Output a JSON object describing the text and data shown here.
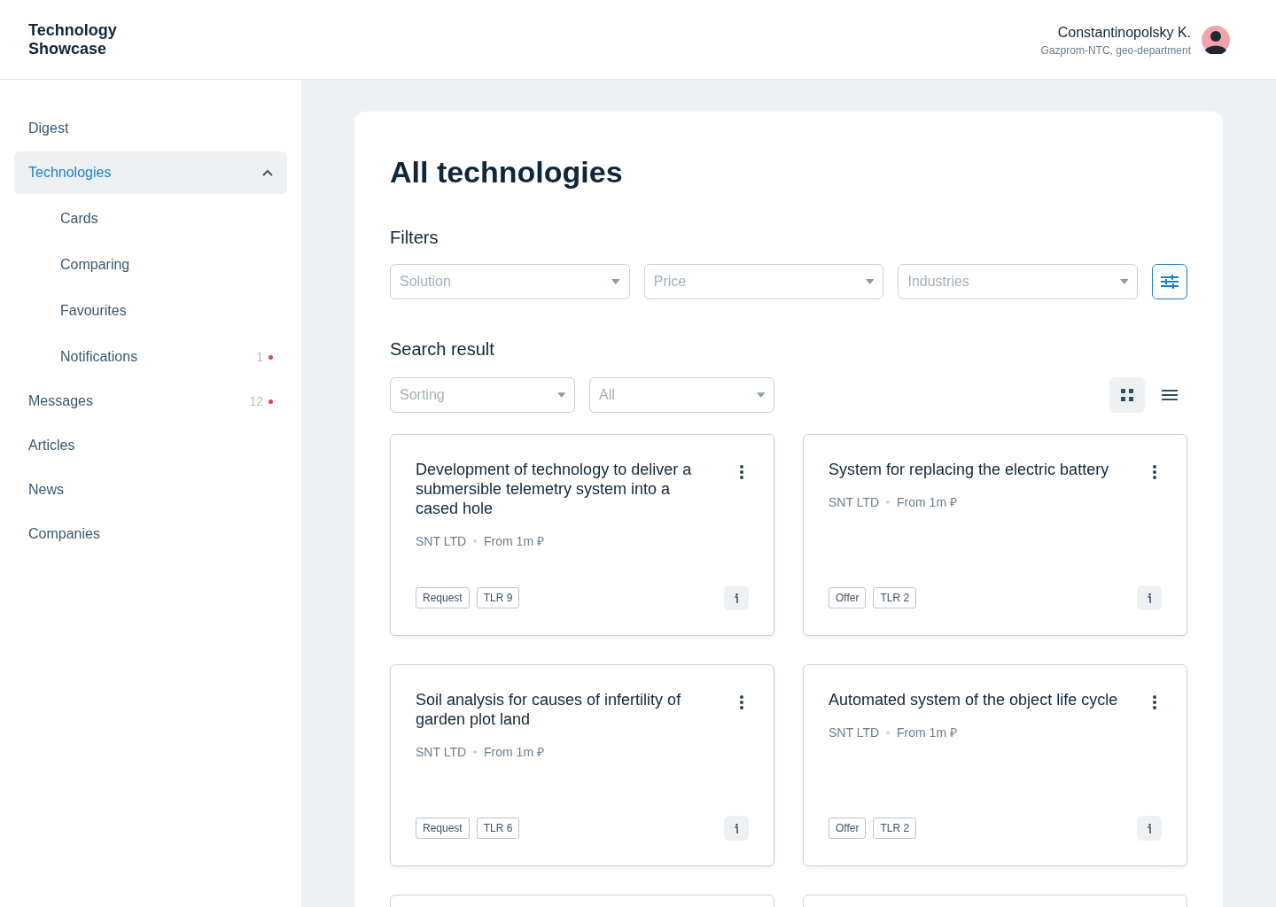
{
  "header": {
    "logo": "Technology Showcase",
    "user": {
      "name": "Constantinopolsky K.",
      "subtitle": "Gazprom-NTC, geo-department"
    }
  },
  "sidebar": {
    "items": [
      {
        "label": "Digest",
        "selected": false
      },
      {
        "label": "Technologies",
        "selected": true,
        "expanded": true,
        "children": [
          {
            "label": "Cards",
            "selected": false
          },
          {
            "label": "Comparing",
            "selected": false
          },
          {
            "label": "Favourites",
            "selected": false
          },
          {
            "label": "Notifications",
            "selected": false,
            "count": "1"
          }
        ]
      },
      {
        "label": "Messages",
        "selected": false,
        "count": "12"
      },
      {
        "label": "Articles",
        "selected": false
      },
      {
        "label": "News",
        "selected": false
      },
      {
        "label": "Companies",
        "selected": false
      }
    ]
  },
  "main": {
    "title": "All technologies",
    "filters_heading": "Filters",
    "filters": [
      {
        "placeholder": "Solution"
      },
      {
        "placeholder": "Price"
      },
      {
        "placeholder": "Industries"
      }
    ],
    "results_heading": "Search result",
    "sort_fields": [
      {
        "placeholder": "Sorting"
      },
      {
        "placeholder": "All"
      }
    ],
    "views": [
      {
        "kind": "grid",
        "selected": true
      },
      {
        "kind": "list",
        "selected": false
      }
    ],
    "cards": [
      {
        "title": "Development of technology to deliver a submersible telemetry system into a cased hole",
        "company": "SNT LTD",
        "price": "From 1m ₽",
        "tags": [
          "Request",
          "TLR 9"
        ]
      },
      {
        "title": "System for replacing the electric battery",
        "company": "SNT LTD",
        "price": "From 1m ₽",
        "tags": [
          "Offer",
          "TLR 2"
        ]
      },
      {
        "title": "Soil analysis for causes of infertility of garden plot land",
        "company": "SNT LTD",
        "price": "From 1m ₽",
        "tags": [
          "Request",
          "TLR 6"
        ]
      },
      {
        "title": "Automated system of the object life cycle",
        "company": "SNT LTD",
        "price": "From 1m ₽",
        "tags": [
          "Offer",
          "TLR 2"
        ]
      }
    ]
  }
}
